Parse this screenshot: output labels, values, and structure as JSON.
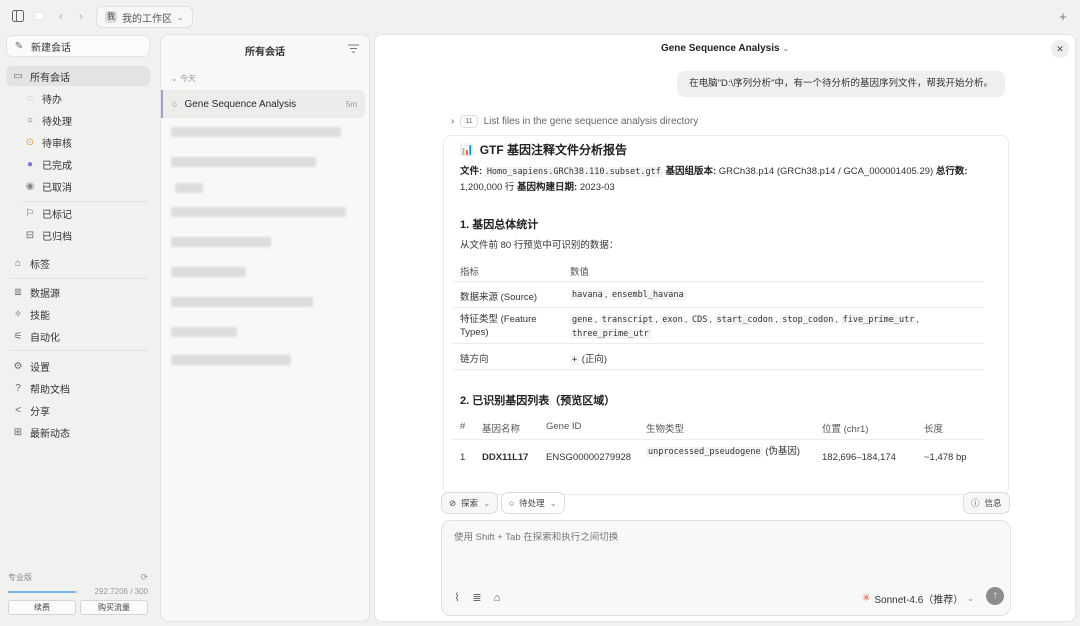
{
  "titlebar": {
    "workspace_badge": "我",
    "workspace_label": "我的工作区",
    "plus": "+"
  },
  "sidebar": {
    "new_chat": "新建会话",
    "all_sessions": "所有会话",
    "status_items": [
      "待办",
      "待处理",
      "待审核",
      "已完成",
      "已取消"
    ],
    "flagged": "已标记",
    "archived": "已归档",
    "tags": "标签",
    "tools": [
      "数据源",
      "技能",
      "自动化"
    ],
    "settings_items": [
      "设置",
      "帮助文档",
      "分享",
      "最新动态"
    ],
    "plan": {
      "label": "专业版",
      "usage": "292.7206 / 300",
      "usage_fraction": 0.976,
      "renew": "续费",
      "buy_traffic": "购买流量"
    }
  },
  "convlist": {
    "title": "所有会话",
    "group": "今天",
    "active": {
      "title": "Gene Sequence Analysis",
      "time": "5m"
    }
  },
  "main": {
    "title": "Gene Sequence Analysis",
    "user_message": "在电脑\"D:\\序列分析\"中，有一个待分析的基因序列文件，帮我开始分析。",
    "tool_count": "11",
    "tool_label": "List files in the gene sequence analysis directory",
    "report": {
      "icon": "📊",
      "title": "GTF 基因注释文件分析报告",
      "file_label": "文件:",
      "file_name": "Homo_sapiens.GRCh38.110.subset.gtf",
      "version_label": "基因组版本:",
      "version": "GRCh38.p14 (GRCh38.p14 / GCA_000001405.29)",
      "lines_label": "总行数:",
      "lines": "1,200,000 行",
      "date_label": "基因构建日期:",
      "date": "2023-03",
      "s1_title": "1. 基因总体统计",
      "s1_desc": "从文件前 80 行预览中可识别的数据：",
      "t1_headers": [
        "指标",
        "数值"
      ],
      "t1_rows": [
        {
          "metric": "数据来源 (Source)",
          "codes": [
            "havana",
            "ensembl_havana"
          ]
        },
        {
          "metric": "特征类型 (Feature Types)",
          "codes": [
            "gene",
            "transcript",
            "exon",
            "CDS",
            "start_codon",
            "stop_codon",
            "five_prime_utr",
            "three_prime_utr"
          ]
        },
        {
          "metric": "链方向",
          "code": "+",
          "suffix": "(正向)"
        }
      ],
      "s2_title": "2. 已识别基因列表（预览区域）",
      "t2_headers": [
        "#",
        "基因名称",
        "Gene ID",
        "生物类型",
        "位置 (chr1)",
        "长度"
      ],
      "t2_rows": [
        {
          "num": "1",
          "name": "DDX11L17",
          "id": "ENSG00000279928",
          "biotype_code": "unprocessed_pseudogene",
          "biotype_suffix": "(伪基因)",
          "position": "182,696–184,174",
          "length": "~1,478 bp"
        }
      ]
    }
  },
  "composer": {
    "mode": "探索",
    "status": "待处理",
    "info": "信息",
    "placeholder": "使用 Shift + Tab 在探索和执行之间切换",
    "model": "Sonnet-4.6（推荐）"
  },
  "colors": {
    "accent_purple": "#a997d8",
    "pending_review": "#e0a030",
    "completed": "#8a6fd6",
    "model_star": "#e8613c"
  }
}
